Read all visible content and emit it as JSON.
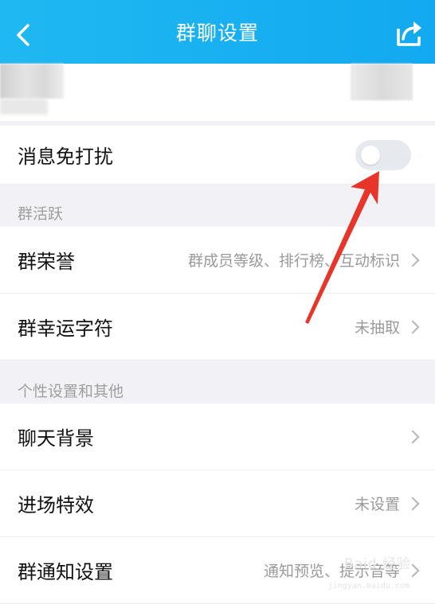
{
  "header": {
    "title": "群聊设置",
    "back_icon": "chevron-left-icon",
    "share_icon": "share-icon",
    "color": "#17b1f1"
  },
  "dnd": {
    "label": "消息免打扰",
    "enabled": false
  },
  "sections": {
    "activity": {
      "title": "群活跃"
    },
    "personal": {
      "title": "个性设置和其他"
    }
  },
  "rows": {
    "honor": {
      "label": "群荣誉",
      "value": "群成员等级、排行榜、互动标识"
    },
    "lucky": {
      "label": "群幸运字符",
      "value": "未抽取"
    },
    "background": {
      "label": "聊天背景"
    },
    "entrance": {
      "label": "进场特效",
      "value": "未设置"
    },
    "notify": {
      "label": "群通知设置",
      "value": "通知预览、提示音等"
    }
  },
  "annotation": {
    "color": "#e8352a"
  },
  "watermark": {
    "text": "Baid 经验",
    "sub": "jingyan.baidu.com"
  }
}
